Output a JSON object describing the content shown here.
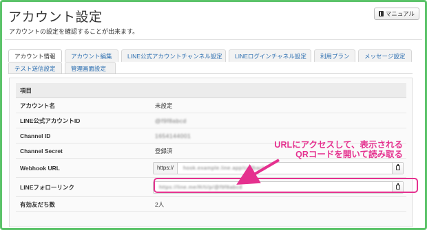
{
  "page": {
    "title": "アカウント設定",
    "subtitle": "アカウントの設定を確認することが出来ます。",
    "manual_button": "マニュアル",
    "accent_color": "#5cc36a"
  },
  "tabs": [
    {
      "label": "アカウント情報",
      "active": true
    },
    {
      "label": "アカウント編集",
      "active": false
    },
    {
      "label": "LINE公式アカウントチャンネル設定",
      "active": false
    },
    {
      "label": "LINEログインチャネル設定",
      "active": false
    },
    {
      "label": "利用プラン",
      "active": false
    },
    {
      "label": "メッセージ設定",
      "active": false
    },
    {
      "label": "テスト送信設定",
      "active": false
    },
    {
      "label": "管理画面設定",
      "active": false
    }
  ],
  "table": {
    "header": "項目",
    "rows": {
      "account_name": {
        "label": "アカウント名",
        "value": "未設定"
      },
      "line_id": {
        "label": "LINE公式アカウントID",
        "value": "@f9f8abcd"
      },
      "channel_id": {
        "label": "Channel ID",
        "value": "1654144001"
      },
      "channel_secret": {
        "label": "Channel Secret",
        "value": "登録済"
      },
      "webhook": {
        "label": "Webhook URL",
        "prefix": "https://",
        "value": "hook.example.line.app/callback"
      },
      "follow_link": {
        "label": "LINEフォローリンク",
        "value": "https://line.me/R/ti/p/@f9f8abcd"
      },
      "friends": {
        "label": "有効友だち数",
        "value": "2人"
      }
    }
  },
  "annotation": {
    "line1": "URLにアクセスして、表示される",
    "line2": "QRコードを開いて読み取る",
    "color": "#e5318f"
  }
}
